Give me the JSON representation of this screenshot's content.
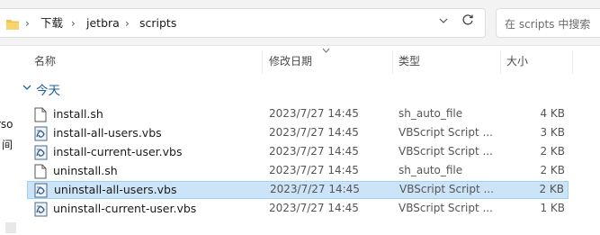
{
  "address_bar": {
    "folder_icon": "folder-icon",
    "breadcrumbs": [
      "下载",
      "jetbra",
      "scripts"
    ],
    "separator": "›",
    "dropdown_icon": "chevron-down-icon",
    "refresh_icon": "refresh-icon",
    "refresh_glyph": "C"
  },
  "search": {
    "placeholder": "在 scripts 中搜索"
  },
  "left_pane": {
    "partial_labels": [
      "rso",
      "间"
    ]
  },
  "columns": {
    "name": "名称",
    "date": "修改日期",
    "type": "类型",
    "size": "大小"
  },
  "group": {
    "label": "今天",
    "chevron": "∨"
  },
  "files": [
    {
      "name": "install.sh",
      "date": "2023/7/27 14:45",
      "type": "sh_auto_file",
      "size": "4 KB",
      "icon": "text-file-icon",
      "selected": false
    },
    {
      "name": "install-all-users.vbs",
      "date": "2023/7/27 14:45",
      "type": "VBScript Script ...",
      "size": "3 KB",
      "icon": "vbscript-file-icon",
      "selected": false
    },
    {
      "name": "install-current-user.vbs",
      "date": "2023/7/27 14:45",
      "type": "VBScript Script ...",
      "size": "2 KB",
      "icon": "vbscript-file-icon",
      "selected": false
    },
    {
      "name": "uninstall.sh",
      "date": "2023/7/27 14:45",
      "type": "sh_auto_file",
      "size": "2 KB",
      "icon": "text-file-icon",
      "selected": false
    },
    {
      "name": "uninstall-all-users.vbs",
      "date": "2023/7/27 14:45",
      "type": "VBScript Script ...",
      "size": "2 KB",
      "icon": "vbscript-file-icon",
      "selected": true
    },
    {
      "name": "uninstall-current-user.vbs",
      "date": "2023/7/27 14:45",
      "type": "VBScript Script ...",
      "size": "1 KB",
      "icon": "vbscript-file-icon",
      "selected": false
    }
  ],
  "colors": {
    "accent": "#1f5fa8",
    "selection_bg": "#cce4f7",
    "selection_border": "#99d1ff"
  }
}
